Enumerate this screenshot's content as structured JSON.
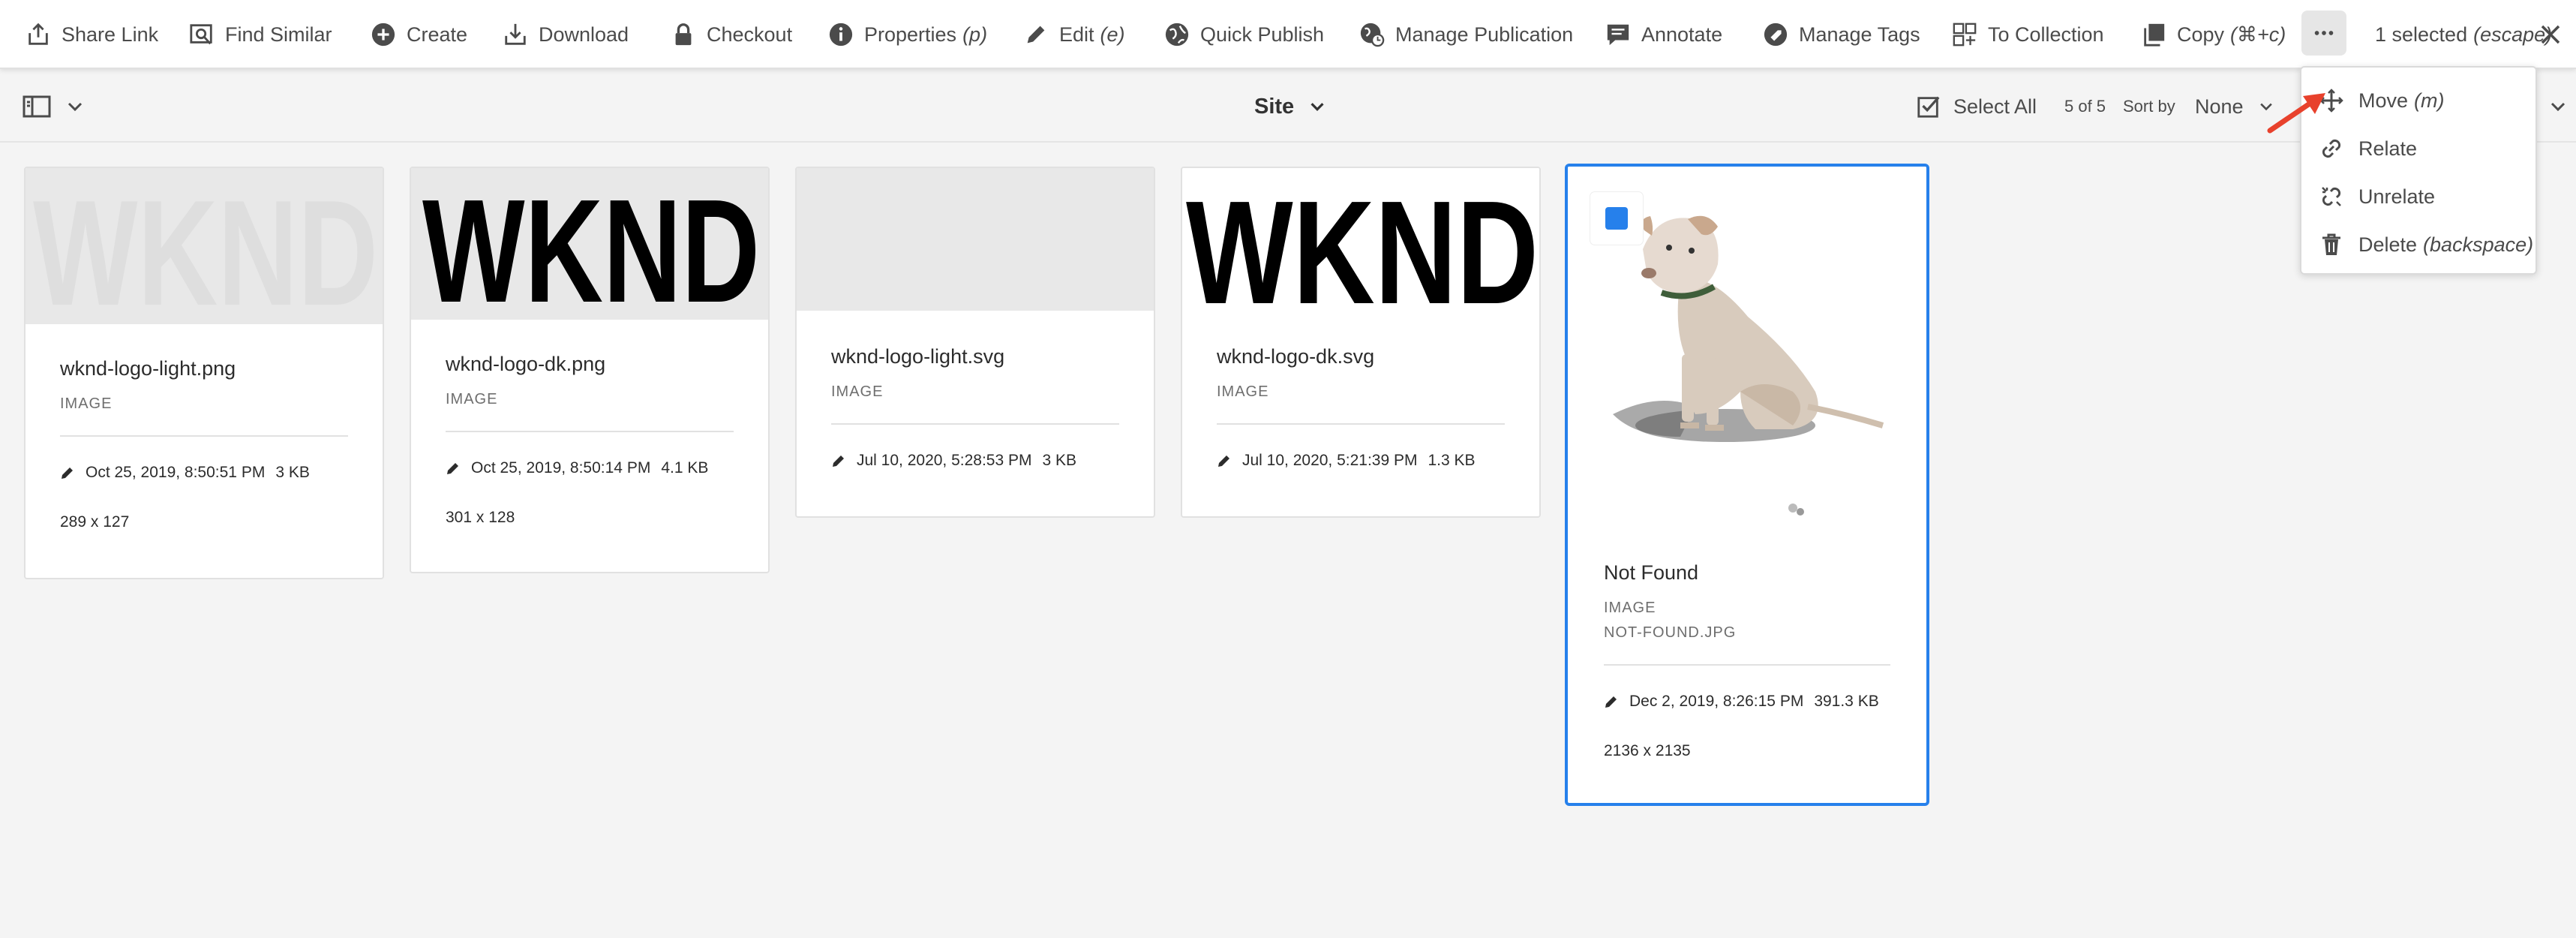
{
  "actionbar": {
    "items": [
      {
        "label": "Share Link",
        "hint": ""
      },
      {
        "label": "Find Similar",
        "hint": ""
      },
      {
        "label": "Create",
        "hint": ""
      },
      {
        "label": "Download",
        "hint": ""
      },
      {
        "label": "Checkout",
        "hint": ""
      },
      {
        "label": "Properties",
        "hint": "(p)"
      },
      {
        "label": "Edit",
        "hint": "(e)"
      },
      {
        "label": "Quick Publish",
        "hint": ""
      },
      {
        "label": "Manage Publication",
        "hint": ""
      },
      {
        "label": "Annotate",
        "hint": ""
      },
      {
        "label": "Manage Tags",
        "hint": ""
      },
      {
        "label": "To Collection",
        "hint": ""
      },
      {
        "label": "Copy",
        "hint": "(⌘+c)"
      }
    ],
    "selected_label": "1 selected",
    "selected_hint": "(escape)"
  },
  "toolbar": {
    "site_label": "Site",
    "select_all_label": "Select All",
    "count": "5 of 5",
    "sort_by_label": "Sort by",
    "sort_value": "None"
  },
  "cards": [
    {
      "title": "wknd-logo-light.png",
      "type": "IMAGE",
      "subtype": "",
      "date": "Oct 25, 2019, 8:50:51 PM",
      "size": "3 KB",
      "dimensions": "289 x 127",
      "thumb_text": "WKND"
    },
    {
      "title": "wknd-logo-dk.png",
      "type": "IMAGE",
      "subtype": "",
      "date": "Oct 25, 2019, 8:50:14 PM",
      "size": "4.1 KB",
      "dimensions": "301 x 128",
      "thumb_text": "WKND"
    },
    {
      "title": "wknd-logo-light.svg",
      "type": "IMAGE",
      "subtype": "",
      "date": "Jul 10, 2020, 5:28:53 PM",
      "size": "3 KB",
      "dimensions": "",
      "thumb_text": ""
    },
    {
      "title": "wknd-logo-dk.svg",
      "type": "IMAGE",
      "subtype": "",
      "date": "Jul 10, 2020, 5:21:39 PM",
      "size": "1.3 KB",
      "dimensions": "",
      "thumb_text": "WKND"
    },
    {
      "title": "Not Found",
      "type": "IMAGE",
      "subtype": "NOT-FOUND.JPG",
      "date": "Dec 2, 2019, 8:26:15 PM",
      "size": "391.3 KB",
      "dimensions": "2136 x 2135",
      "thumb_text": ""
    }
  ],
  "more_menu": {
    "items": [
      {
        "label": "Move",
        "hint": "(m)",
        "icon": "move-icon"
      },
      {
        "label": "Relate",
        "hint": "",
        "icon": "link-icon"
      },
      {
        "label": "Unrelate",
        "hint": "",
        "icon": "unlink-icon"
      },
      {
        "label": "Delete",
        "hint": "(backspace)",
        "icon": "trash-icon"
      }
    ]
  },
  "colors": {
    "accent": "#2680eb",
    "annotation_arrow": "#e8412c"
  }
}
